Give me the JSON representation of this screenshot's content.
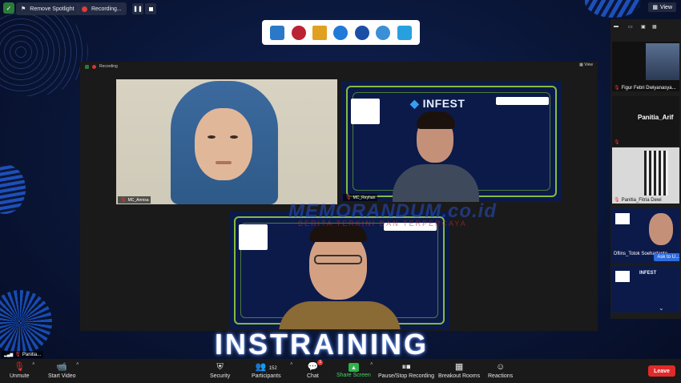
{
  "top_bar": {
    "remove_spotlight": "Remove Spotlight",
    "recording": "Recording...",
    "view": "View"
  },
  "inner_bar": {
    "recording": "Recording",
    "view": "View"
  },
  "tiles": [
    {
      "name": "MC_Annisa"
    },
    {
      "name": "MC_Reyhan"
    },
    {
      "name": ""
    }
  ],
  "infest_logo": "INFEST",
  "watermark": {
    "main": "MEMORANDUM.co.id",
    "sub": "BERITA TERKINI DAN TERPERCAYA"
  },
  "banner": "INSTRAINING",
  "side_strip": {
    "participants": [
      {
        "name": "Figur Febri Dwiyanasya..."
      },
      {
        "name": "Panitia_Arif",
        "big_name": "Panitia_Arif"
      },
      {
        "name": "Panitia_Fitria Dewi"
      },
      {
        "name": "Dflins_Totok Soehartanto"
      },
      {
        "name": ""
      }
    ],
    "ask_to_unmute": "Ask to U..."
  },
  "bottom_left_name": "Panitia...",
  "toolbar": {
    "unmute": "Unmute",
    "start_video": "Start Video",
    "security": "Security",
    "participants": "Participants",
    "participants_count": "152",
    "chat": "Chat",
    "chat_badge": "1",
    "share_screen": "Share Screen",
    "pause_stop_recording": "Pause/Stop Recording",
    "breakout_rooms": "Breakout Rooms",
    "reactions": "Reactions",
    "leave": "Leave"
  },
  "colors": {
    "background": "#0a1638",
    "leave": "#e12a2a",
    "share_green": "#2eb24a",
    "circuit_green": "#9bd83a"
  }
}
